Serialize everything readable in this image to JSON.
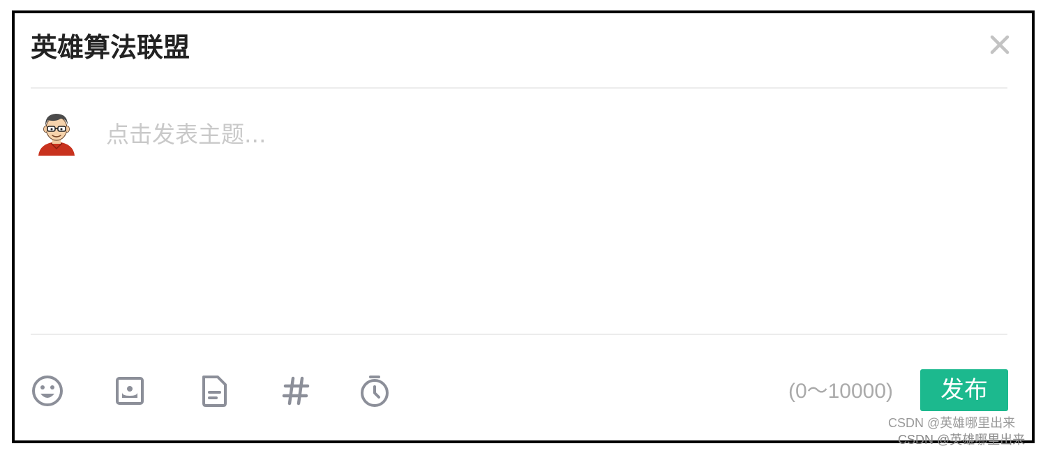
{
  "dialog": {
    "title": "英雄算法联盟",
    "close_icon": "close-icon"
  },
  "composer": {
    "avatar": "user-avatar-cartoon",
    "placeholder": "点击发表主题...",
    "value": ""
  },
  "toolbar": {
    "tools": [
      {
        "name": "emoji",
        "icon": "emoji-icon"
      },
      {
        "name": "image",
        "icon": "image-icon"
      },
      {
        "name": "document",
        "icon": "document-icon"
      },
      {
        "name": "topic",
        "icon": "hashtag-icon"
      },
      {
        "name": "timer",
        "icon": "timer-icon"
      }
    ],
    "counter": "(0～10000)",
    "publish_label": "发布"
  },
  "colors": {
    "accent": "#1cb98e",
    "icon_gray": "#8c8f99",
    "placeholder_gray": "#c9c9c9",
    "border": "#000000"
  },
  "watermark": {
    "line1": "CSDN @英雄哪里出来",
    "line2": "CSDN @英雄哪里出来"
  }
}
